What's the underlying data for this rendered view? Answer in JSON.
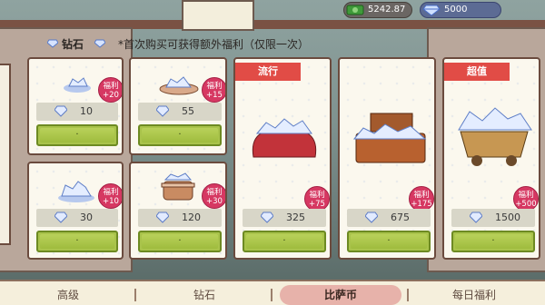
{
  "hud": {
    "coins": "5242.87",
    "gems": "5000",
    "coin_icon": "cash-icon",
    "gem_icon": "diamond-icon"
  },
  "banner": {
    "title": "钻石",
    "note": "*首次购买可获得额外福利（仅限一次）"
  },
  "colors": {
    "buy_button": "#a9c34b",
    "badge": "#d63862",
    "ribbon": "#e14c46",
    "tab_selected": "#e7b2aa"
  },
  "bonus_label": "福利",
  "packs": [
    {
      "price": "10",
      "bonus": "+20",
      "buy_label": "·",
      "icon": "small-gem-pile"
    },
    {
      "price": "55",
      "bonus": "+15",
      "buy_label": "·",
      "icon": "gem-plate"
    },
    {
      "price": "30",
      "bonus": "+10",
      "buy_label": "·",
      "icon": "gem-cluster"
    },
    {
      "price": "120",
      "bonus": "+30",
      "buy_label": "·",
      "icon": "gem-bucket"
    },
    {
      "ribbon": "流行",
      "price": "325",
      "bonus": "+75",
      "buy_label": "·",
      "icon": "gem-sack"
    },
    {
      "price": "675",
      "bonus": "+175",
      "buy_label": "·",
      "icon": "gem-suitcase"
    },
    {
      "ribbon": "超值",
      "price": "1500",
      "bonus": "+500",
      "buy_label": "·",
      "icon": "gem-mine-cart"
    }
  ],
  "tabs": [
    {
      "label": "高级"
    },
    {
      "label": "钻石"
    },
    {
      "label": "比萨币",
      "selected": true
    },
    {
      "label": "每日福利"
    }
  ]
}
